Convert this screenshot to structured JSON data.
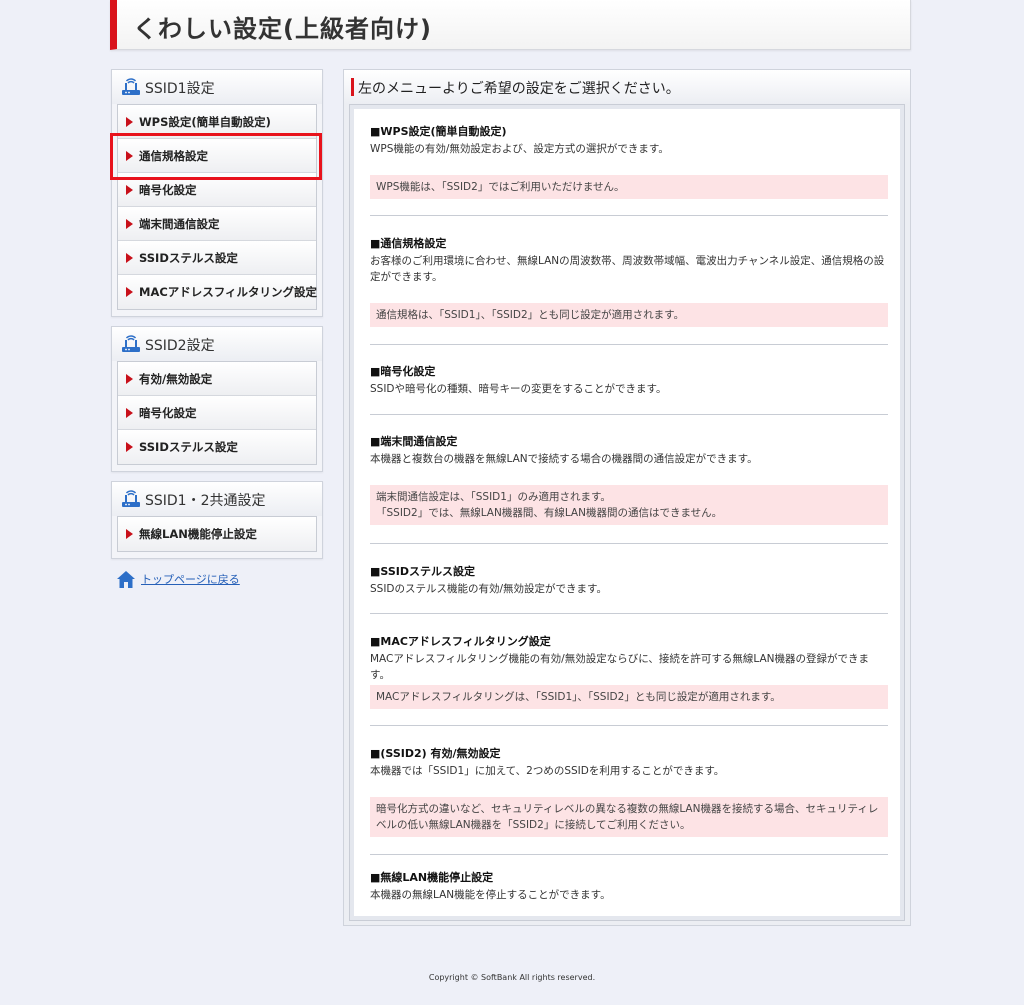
{
  "header": {
    "title": "くわしい設定(上級者向け)"
  },
  "sidebar": {
    "panels": [
      {
        "title": "SSID1設定",
        "items": [
          "WPS設定(簡単自動設定)",
          "通信規格設定",
          "暗号化設定",
          "端末間通信設定",
          "SSIDステルス設定",
          "MACアドレスフィルタリング設定"
        ]
      },
      {
        "title": "SSID2設定",
        "items": [
          "有効/無効設定",
          "暗号化設定",
          "SSIDステルス設定"
        ]
      },
      {
        "title": "SSID1・2共通設定",
        "items": [
          "無線LAN機能停止設定"
        ]
      }
    ],
    "selected_item": "通信規格設定",
    "top_link": "トップページに戻る"
  },
  "main": {
    "title": "左のメニューよりご希望の設定をご選択ください。",
    "sections": [
      {
        "heading": "■WPS設定(簡単自動設定)",
        "desc": "WPS機能の有効/無効設定および、設定方式の選択ができます。",
        "note": "WPS機能は、「SSID2」ではご利用いただけません。"
      },
      {
        "heading": "■通信規格設定",
        "desc": "お客様のご利用環境に合わせ、無線LANの周波数帯、周波数帯域幅、電波出力チャンネル設定、通信規格の設定ができます。",
        "note": "通信規格は、「SSID1」、「SSID2」とも同じ設定が適用されます。"
      },
      {
        "heading": "■暗号化設定",
        "desc": "SSIDや暗号化の種類、暗号キーの変更をすることができます。"
      },
      {
        "heading": "■端末間通信設定",
        "desc": "本機器と複数台の機器を無線LANで接続する場合の機器間の通信設定ができます。",
        "note": "端末間通信設定は、「SSID1」のみ適用されます。\n「SSID2」では、無線LAN機器間、有線LAN機器間の通信はできません。"
      },
      {
        "heading": "■SSIDステルス設定",
        "desc": "SSIDのステルス機能の有効/無効設定ができます。"
      },
      {
        "heading": "■MACアドレスフィルタリング設定",
        "desc": "MACアドレスフィルタリング機能の有効/無効設定ならびに、接続を許可する無線LAN機器の登録ができます。",
        "note": "MACアドレスフィルタリングは、「SSID1」、「SSID2」とも同じ設定が適用されます。"
      },
      {
        "heading": "■(SSID2) 有効/無効設定",
        "desc": "本機器では「SSID1」に加えて、2つめのSSIDを利用することができます。",
        "note": "暗号化方式の違いなど、セキュリティレベルの異なる複数の無線LAN機器を接続する場合、セキュリティレベルの低い無線LAN機器を「SSID2」に接続してご利用ください。"
      },
      {
        "heading": "■無線LAN機能停止設定",
        "desc": "本機器の無線LAN機能を停止することができます。"
      }
    ]
  },
  "footer": {
    "copyright": "Copyright © SoftBank All rights reserved."
  },
  "colors": {
    "accent": "#d9131b",
    "note_bg": "#fde3e5",
    "link": "#2660b8",
    "page_bg": "#eef0f8"
  },
  "icons": {
    "panel": "wifi-router-icon",
    "menu": "red-arrow-icon",
    "home": "home-icon"
  }
}
